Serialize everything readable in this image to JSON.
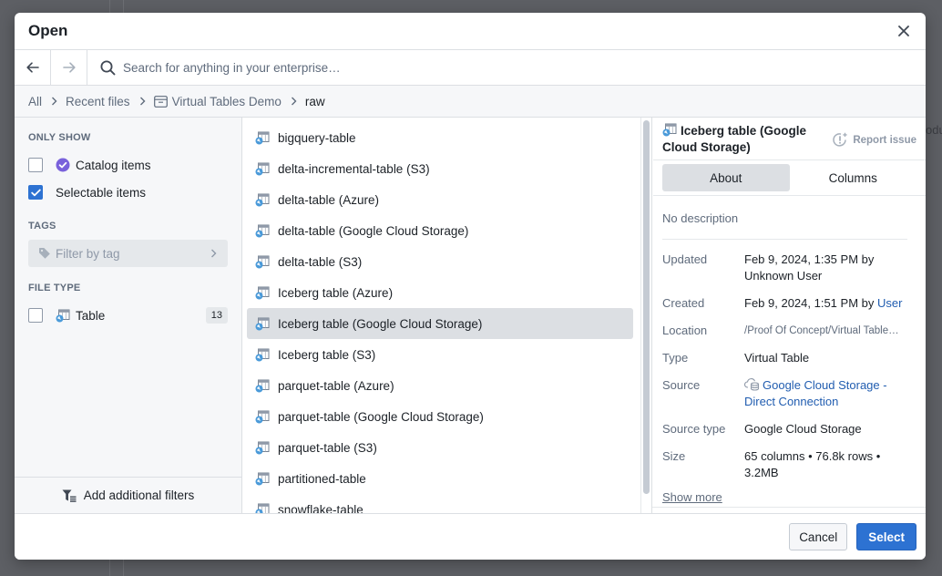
{
  "dialog": {
    "title": "Open",
    "close_icon": "close-icon"
  },
  "search": {
    "placeholder": "Search for anything in your enterprise…",
    "value": "",
    "back_icon": "arrow-left-icon",
    "forward_icon": "arrow-right-icon"
  },
  "breadcrumb": {
    "items": [
      {
        "label": "All"
      },
      {
        "label": "Recent files"
      },
      {
        "label": "Virtual Tables Demo",
        "icon": "folder-icon"
      },
      {
        "label": "raw"
      }
    ]
  },
  "filters": {
    "only_show_label": "ONLY SHOW",
    "only_show": [
      {
        "label": "Catalog items",
        "checked": false,
        "icon": "verified-badge-icon"
      },
      {
        "label": "Selectable items",
        "checked": true
      }
    ],
    "tags_label": "TAGS",
    "tag_placeholder": "Filter by tag",
    "file_type_label": "FILE TYPE",
    "file_types": [
      {
        "label": "Table",
        "checked": false,
        "count": "13",
        "icon": "virtual-table-icon"
      }
    ],
    "add_filters_label": "Add additional filters"
  },
  "files": {
    "items": [
      {
        "name": "bigquery-table"
      },
      {
        "name": "delta-incremental-table (S3)"
      },
      {
        "name": "delta-table (Azure)"
      },
      {
        "name": "delta-table (Google Cloud Storage)"
      },
      {
        "name": "delta-table (S3)"
      },
      {
        "name": "Iceberg table (Azure)"
      },
      {
        "name": "Iceberg table (Google Cloud Storage)",
        "selected": true
      },
      {
        "name": "Iceberg table (S3)"
      },
      {
        "name": "parquet-table (Azure)"
      },
      {
        "name": "parquet-table (Google Cloud Storage)"
      },
      {
        "name": "parquet-table (S3)"
      },
      {
        "name": "partitioned-table"
      },
      {
        "name": "snowflake-table"
      }
    ]
  },
  "details": {
    "title": "Iceberg table (Google Cloud Storage)",
    "report_issue": "Report issue",
    "tabs": [
      {
        "label": "About",
        "active": true
      },
      {
        "label": "Columns",
        "active": false
      }
    ],
    "description": "No description",
    "props": {
      "updated": {
        "key": "Updated",
        "value": "Feb 9, 2024, 1:35 PM by Unknown User"
      },
      "created": {
        "key": "Created",
        "value": "Feb 9, 2024, 1:51 PM by ",
        "user": "User"
      },
      "location": {
        "key": "Location",
        "value": "/Proof Of Concept/Virtual Table…"
      },
      "type": {
        "key": "Type",
        "value": "Virtual Table"
      },
      "source": {
        "key": "Source",
        "value": "Google Cloud Storage - Direct Connection"
      },
      "source_type": {
        "key": "Source type",
        "value": "Google Cloud Storage"
      },
      "size": {
        "key": "Size",
        "value": "65 columns • 76.8k rows • 3.2MB"
      }
    },
    "show_more": "Show more"
  },
  "footer": {
    "cancel": "Cancel",
    "select": "Select"
  },
  "background": {
    "partial_text": "odu"
  },
  "colors": {
    "primary": "#2d72d2",
    "link": "#215db0",
    "selected_row": "#dcdfe3",
    "catalog_badge": "#7961db",
    "table_icon_dot": "#4a9ad9"
  }
}
